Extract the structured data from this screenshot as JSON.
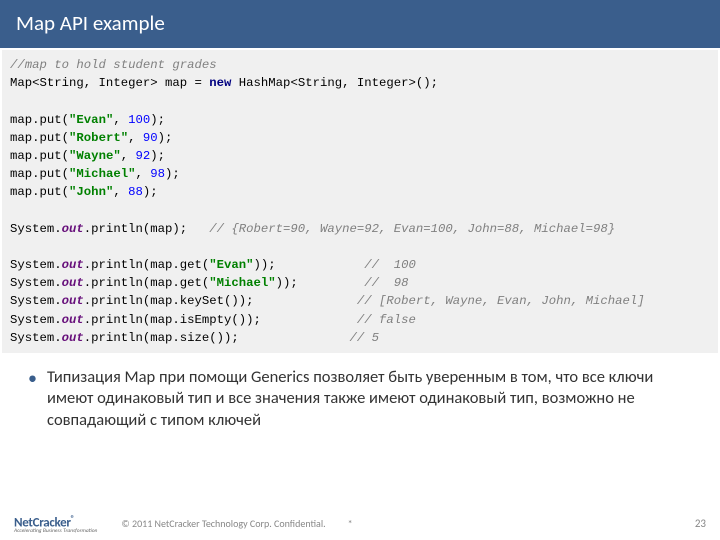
{
  "title": "Map API example",
  "code": {
    "l1_comment": "//map to hold student grades",
    "type1": "Map",
    "gen1": "<String, Integer>",
    "var": " map = ",
    "kw_new": "new",
    "type2": " HashMap",
    "gen2": "<String, Integer>",
    "tail2": "();",
    "put_pre": "map.put(",
    "names": [
      "\"Evan\"",
      "\"Robert\"",
      "\"Wayne\"",
      "\"Michael\"",
      "\"John\""
    ],
    "vals": [
      "100",
      "90",
      "92",
      "98",
      "88"
    ],
    "put_mid": ", ",
    "put_end": ");",
    "sys": "System.",
    "out": "out",
    "print": ".println(map);   ",
    "print_comment": "// {Robert=90, Wayne=92, Evan=100, John=88, Michael=98}",
    "get_pre": ".println(map.get(",
    "get_end": "));",
    "get_c1": "//  100",
    "get_c2": "//  98",
    "key_line": ".println(map.keySet());",
    "key_c": "// [Robert, Wayne, Evan, John, Michael]",
    "empty_line": ".println(map.isEmpty());",
    "empty_c": "// false",
    "size_line": ".println(map.size());",
    "size_c": "// 5"
  },
  "bullet": "Типизация Map при помощи Generics позволяет быть уверенным в том, что все ключи имеют одинаковый тип и все значения также имеют одинаковый тип, возможно не совпадающий с типом ключей",
  "footer": {
    "logo_main": "NetCracker",
    "logo_tag": "Accelerating Business Transformation",
    "copyright": "© 2011 NetCracker Technology Corp. Confidential.",
    "star": "*",
    "page": "23"
  }
}
